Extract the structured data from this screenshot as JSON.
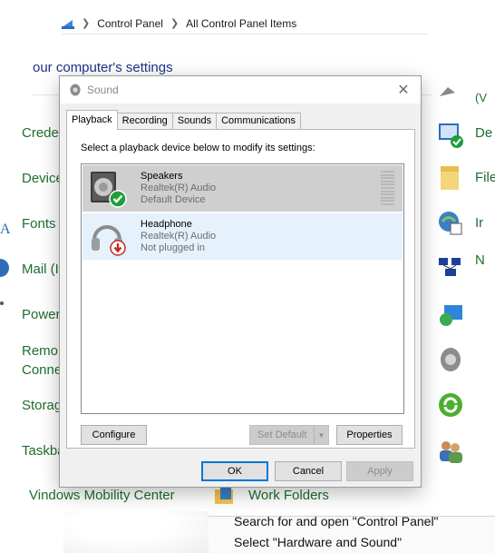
{
  "breadcrumb": {
    "items": [
      "Control Panel",
      "All Control Panel Items"
    ]
  },
  "background": {
    "heading": "our computer's settings",
    "left_items": [
      {
        "label": "Crede"
      },
      {
        "label": "Device"
      },
      {
        "label": "Fonts"
      },
      {
        "label": "Mail (I"
      },
      {
        "label": "Power"
      },
      {
        "label": "Remo"
      },
      {
        "label": "Conne"
      },
      {
        "label": "Storag"
      },
      {
        "label": "Taskba"
      }
    ],
    "right_items": [
      {
        "label": "(V"
      },
      {
        "label": "De"
      },
      {
        "label": "File"
      },
      {
        "label": "Ir"
      },
      {
        "label": "N"
      }
    ],
    "windows_mobility": "Vindows Mobility Center",
    "work_folders": "Work Folders",
    "search_hint_1": "Search for and open \"Control Panel\"",
    "search_hint_2": "Select \"Hardware and Sound\""
  },
  "dialog": {
    "title": "Sound",
    "tabs": [
      "Playback",
      "Recording",
      "Sounds",
      "Communications"
    ],
    "active_tab": "Playback",
    "instruction": "Select a playback device below to modify its settings:",
    "devices": [
      {
        "name": "Speakers",
        "driver": "Realtek(R) Audio",
        "status": "Default Device",
        "state": "selected",
        "badge": "green-check-icon"
      },
      {
        "name": "Headphone",
        "driver": "Realtek(R) Audio",
        "status": "Not plugged in",
        "state": "hover",
        "badge": "red-down-arrow-icon"
      }
    ],
    "buttons": {
      "configure": "Configure",
      "set_default": "Set Default",
      "properties": "Properties",
      "ok": "OK",
      "cancel": "Cancel",
      "apply": "Apply"
    }
  },
  "colors": {
    "link_green": "#1e6e2e",
    "accent_blue": "#0078d7",
    "selected_row": "#cfcfcf",
    "hover_row": "#e5f1fb"
  }
}
